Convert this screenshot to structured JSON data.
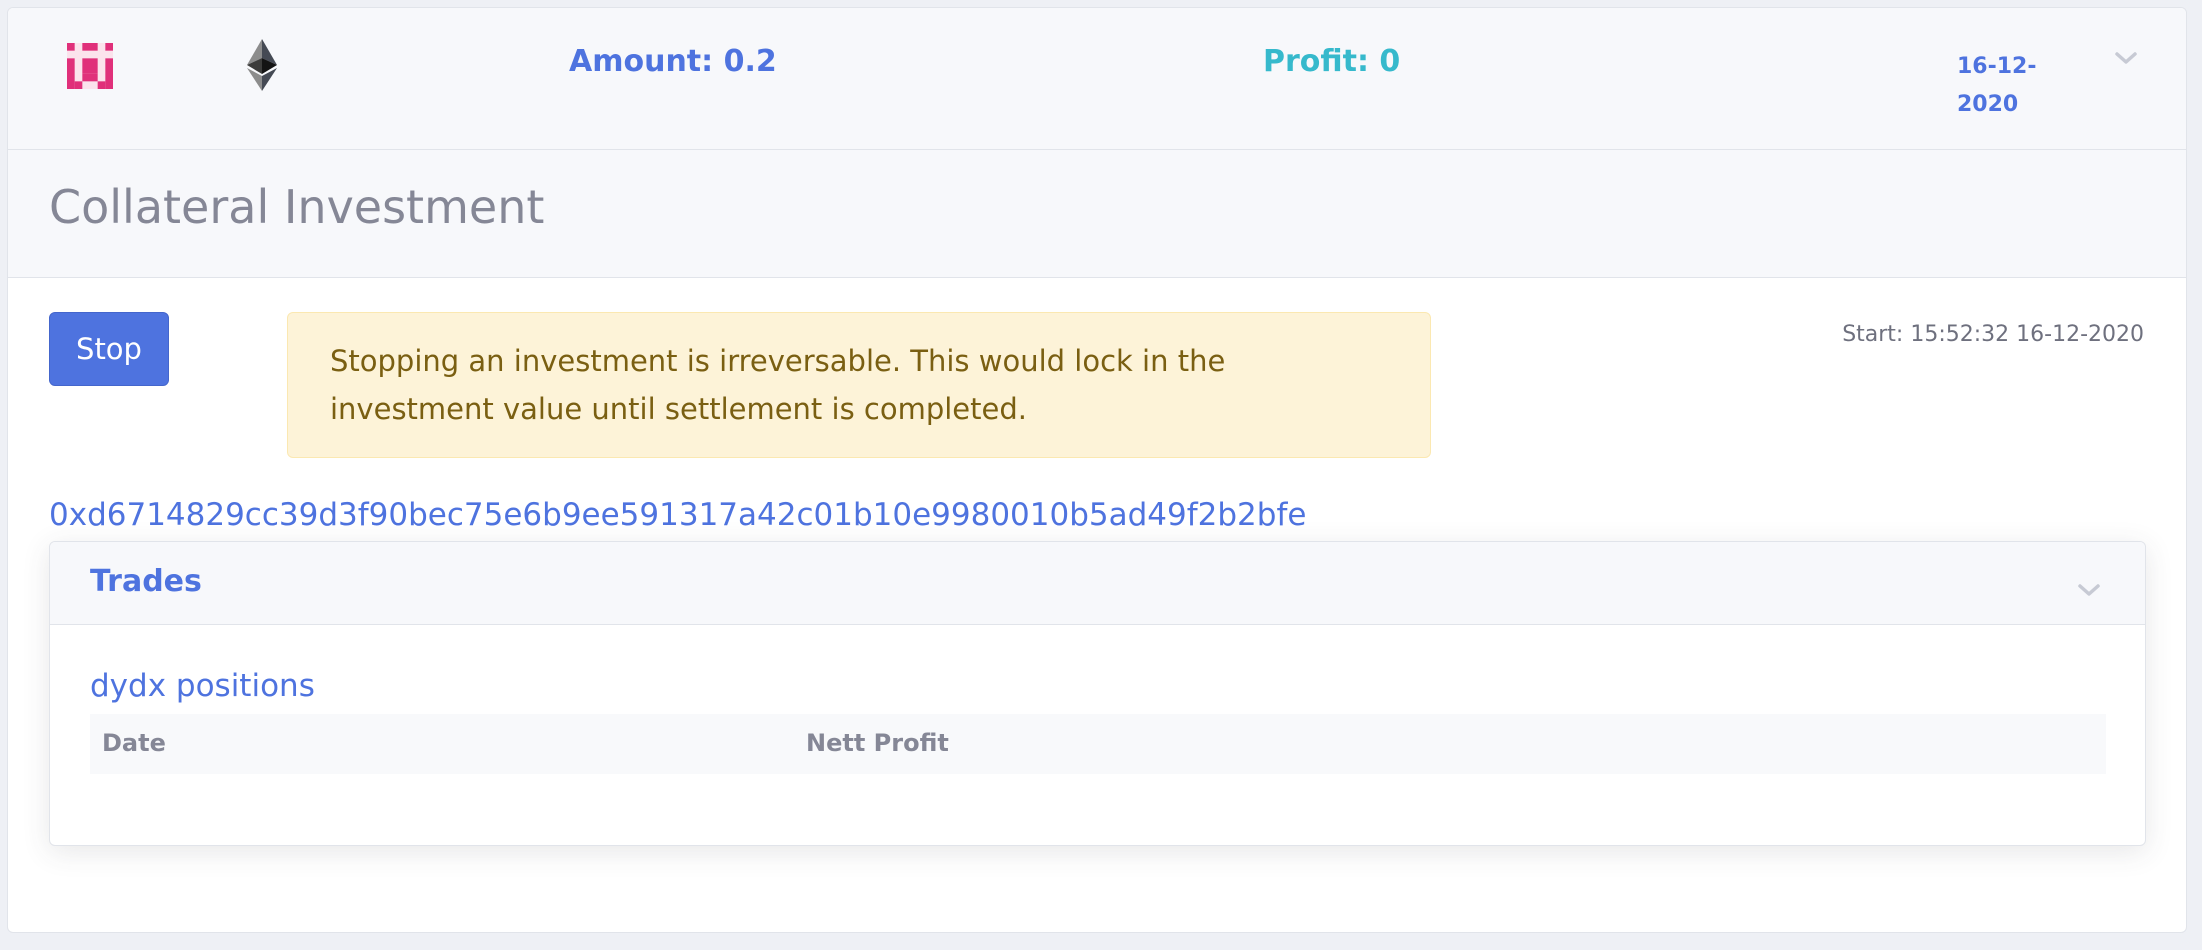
{
  "summary": {
    "amount": "Amount: 0.2",
    "profit": "Profit: 0",
    "date_line1": "16-12-",
    "date_line2": "2020",
    "icons": [
      "app-logo-icon",
      "ethereum-icon",
      "chevron-down-icon"
    ]
  },
  "investment": {
    "title": "Collateral Investment",
    "stop_label": "Stop",
    "warning": "Stopping an investment is irreversable. This would lock in the investment value until settlement is completed.",
    "start": "Start: 15:52:32 16-12-2020",
    "hash": "0xd6714829cc39d3f90bec75e6b9ee591317a42c01b10e9980010b5ad49f2b2bfe"
  },
  "trades": {
    "title": "Trades",
    "subtitle": "dydx positions",
    "columns": [
      "Date",
      "Nett Profit"
    ],
    "rows": []
  },
  "colors": {
    "primary": "#4e73df",
    "info": "#36b9cc",
    "warning_bg": "#fdf3d8",
    "warning_text": "#7a5f12",
    "logo_pink": "#e0307a"
  }
}
